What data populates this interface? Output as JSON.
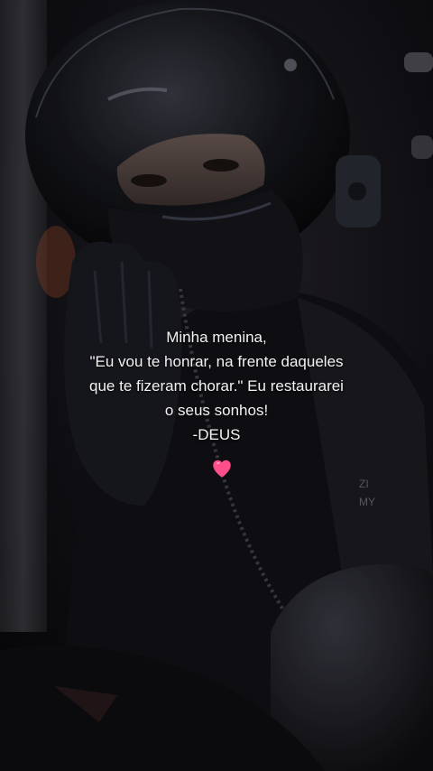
{
  "background": {
    "description_icon": "helmet-rider-photo",
    "accent_colors": [
      "#0b0a0c",
      "#1a1a22",
      "#ff4f8b"
    ]
  },
  "quote": {
    "lines": [
      "Minha menina,",
      "\"Eu vou te honrar, na frente daqueles",
      "que te fizeram chorar.\" Eu restaurarei",
      "o seus sonhos!",
      "-DEUS"
    ]
  },
  "emoji": {
    "icon": "pink-heart-icon",
    "color": "#ff4f8b"
  }
}
